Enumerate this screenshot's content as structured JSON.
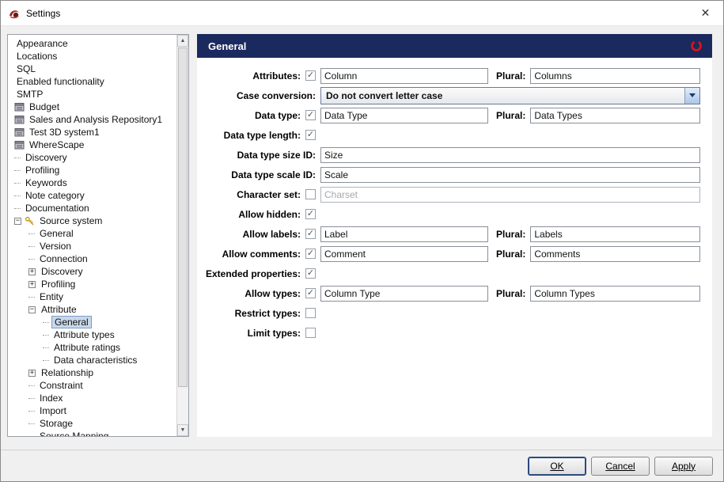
{
  "window": {
    "title": "Settings",
    "close_glyph": "✕"
  },
  "tree": {
    "items": [
      {
        "label": "Appearance",
        "indent": 0
      },
      {
        "label": "Locations",
        "indent": 0
      },
      {
        "label": "SQL",
        "indent": 0
      },
      {
        "label": "Enabled functionality",
        "indent": 0
      },
      {
        "label": "SMTP",
        "indent": 0
      },
      {
        "label": "Budget",
        "indent": 0,
        "icon": "repository-icon"
      },
      {
        "label": "Sales and Analysis Repository1",
        "indent": 0,
        "icon": "repository-icon"
      },
      {
        "label": "Test 3D system1",
        "indent": 0,
        "icon": "repository-icon"
      },
      {
        "label": "WhereScape",
        "indent": 0,
        "icon": "repository-icon"
      },
      {
        "label": "Discovery",
        "indent": 0,
        "dash": true
      },
      {
        "label": "Profiling",
        "indent": 0,
        "dash": true
      },
      {
        "label": "Keywords",
        "indent": 0,
        "dash": true
      },
      {
        "label": "Note category",
        "indent": 0,
        "dash": true
      },
      {
        "label": "Documentation",
        "indent": 0,
        "dash": true
      },
      {
        "label": "Source system",
        "indent": 0,
        "toggle": "open",
        "icon": "keys-icon"
      },
      {
        "label": "General",
        "indent": 1,
        "dash": true
      },
      {
        "label": "Version",
        "indent": 1,
        "dash": true
      },
      {
        "label": "Connection",
        "indent": 1,
        "dash": true
      },
      {
        "label": "Discovery",
        "indent": 1,
        "toggle": "closed"
      },
      {
        "label": "Profiling",
        "indent": 1,
        "toggle": "closed"
      },
      {
        "label": "Entity",
        "indent": 1,
        "dash": true
      },
      {
        "label": "Attribute",
        "indent": 1,
        "toggle": "open"
      },
      {
        "label": "General",
        "indent": 2,
        "dash": true,
        "selected": true
      },
      {
        "label": "Attribute types",
        "indent": 2,
        "dash": true
      },
      {
        "label": "Attribute ratings",
        "indent": 2,
        "dash": true
      },
      {
        "label": "Data characteristics",
        "indent": 2,
        "dash": true
      },
      {
        "label": "Relationship",
        "indent": 1,
        "toggle": "closed"
      },
      {
        "label": "Constraint",
        "indent": 1,
        "dash": true
      },
      {
        "label": "Index",
        "indent": 1,
        "dash": true
      },
      {
        "label": "Import",
        "indent": 1,
        "dash": true
      },
      {
        "label": "Storage",
        "indent": 1,
        "dash": true
      },
      {
        "label": "Source Mapping",
        "indent": 1,
        "dash": true
      }
    ]
  },
  "content": {
    "title": "General"
  },
  "form": {
    "plural_label": "Plural:",
    "rows": [
      {
        "label": "Attributes:",
        "checkbox": true,
        "checked": true,
        "field": "Column",
        "plural": "Columns"
      },
      {
        "label": "Case conversion:",
        "combo": "Do not convert letter case"
      },
      {
        "label": "Data type:",
        "checkbox": true,
        "checked": true,
        "field": "Data Type",
        "plural": "Data Types"
      },
      {
        "label": "Data type length:",
        "checkbox": true,
        "checked": true
      },
      {
        "label": "Data type size ID:",
        "field_full": "Size"
      },
      {
        "label": "Data type scale ID:",
        "field_full": "Scale"
      },
      {
        "label": "Character set:",
        "checkbox": true,
        "checked": false,
        "field_full": "Charset",
        "disabled": true
      },
      {
        "label": "Allow hidden:",
        "checkbox": true,
        "checked": true
      },
      {
        "label": "Allow labels:",
        "checkbox": true,
        "checked": true,
        "field": "Label",
        "plural": "Labels"
      },
      {
        "label": "Allow comments:",
        "checkbox": true,
        "checked": true,
        "field": "Comment",
        "plural": "Comments"
      },
      {
        "label": "Extended properties:",
        "checkbox": true,
        "checked": true
      },
      {
        "label": "Allow types:",
        "checkbox": true,
        "checked": true,
        "field": "Column Type",
        "plural": "Column Types"
      },
      {
        "label": "Restrict types:",
        "checkbox": true,
        "checked": false
      },
      {
        "label": "Limit types:",
        "checkbox": true,
        "checked": false
      }
    ]
  },
  "footer": {
    "buttons": [
      {
        "label": "OK",
        "default": true
      },
      {
        "label": "Cancel",
        "default": false
      },
      {
        "label": "Apply",
        "default": false
      }
    ]
  },
  "colors": {
    "header_bg": "#1b2a5e",
    "accent_red": "#dd1616",
    "selection_bg": "#c8d8ea",
    "selection_border": "#7c9cc4"
  }
}
